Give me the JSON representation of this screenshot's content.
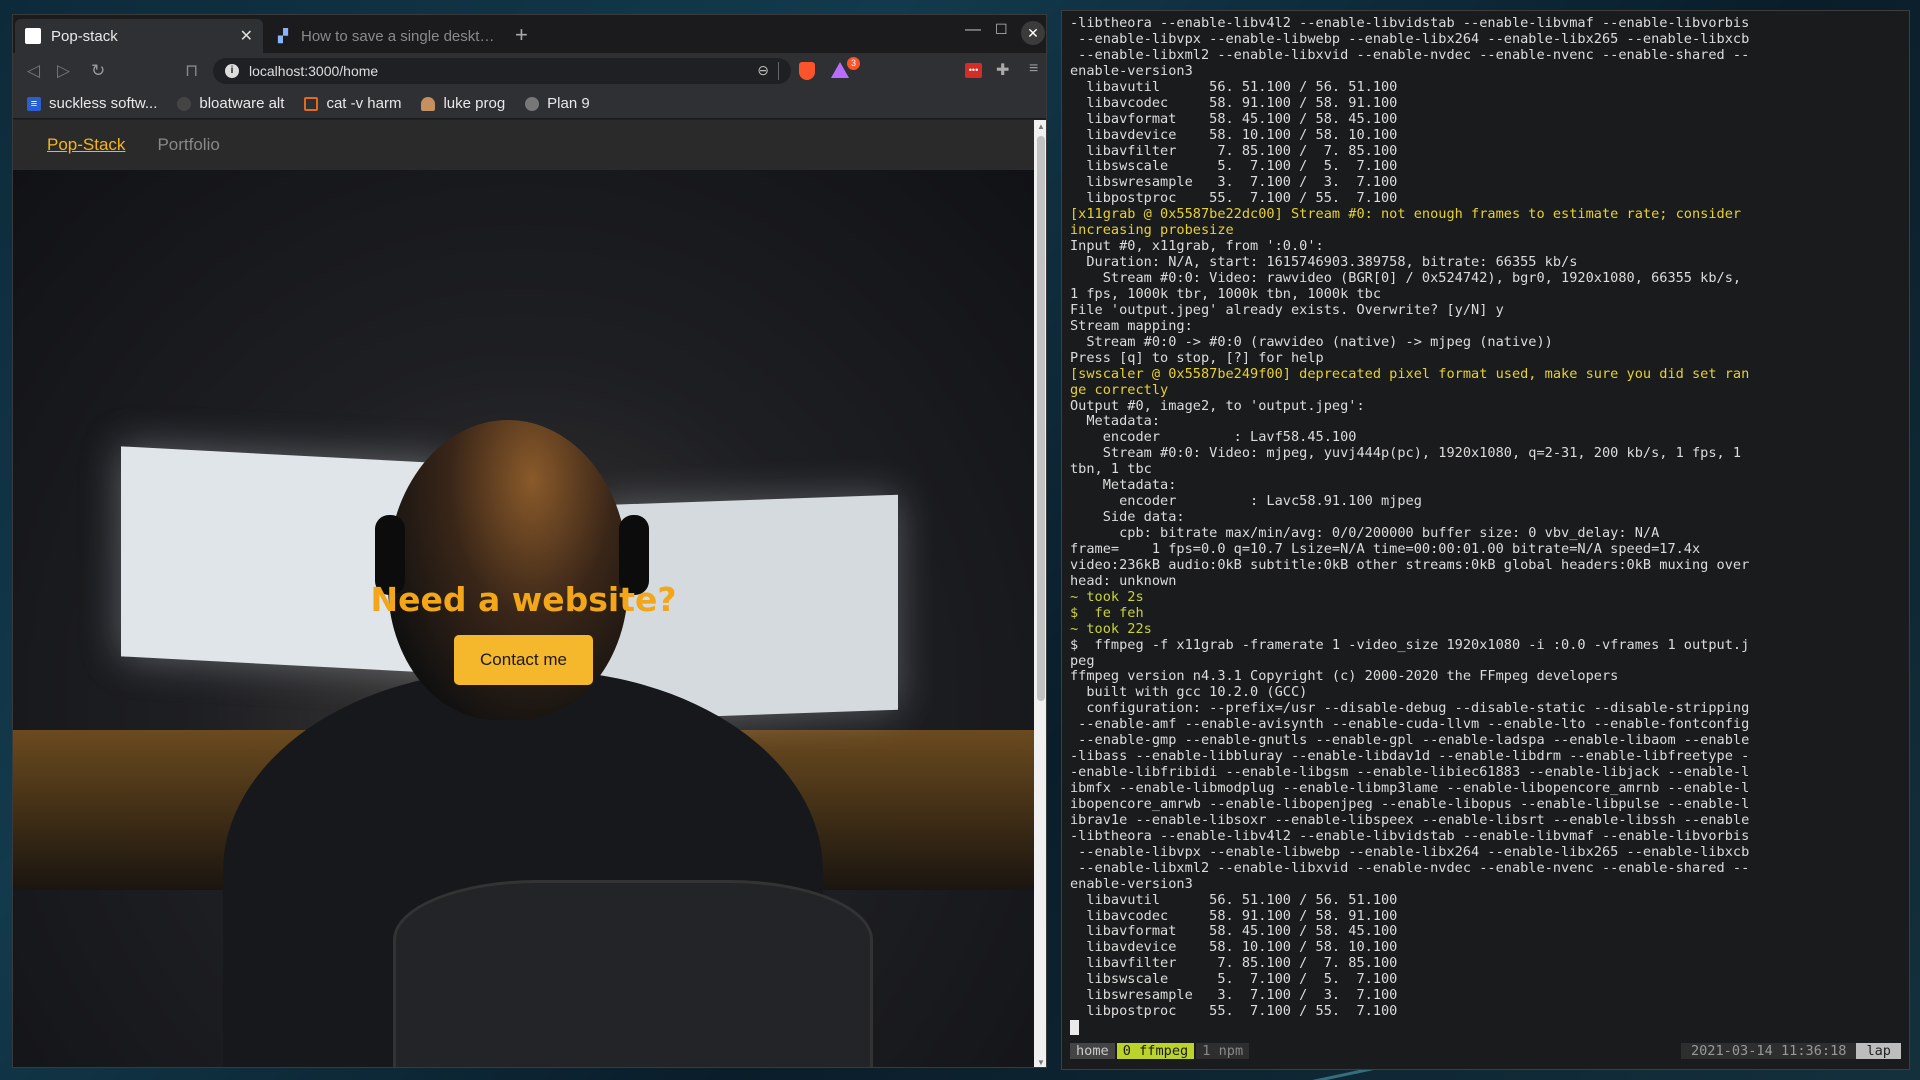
{
  "browser": {
    "tabs": [
      {
        "title": "Pop-stack",
        "close": "✕"
      },
      {
        "title": "How to save a single desktop"
      }
    ],
    "new_tab": "+",
    "window_controls": {
      "minimize": "—",
      "maximize": "☐",
      "close": "✕"
    },
    "url": "localhost:3000/home",
    "rewards_badge": "3",
    "bookmarks": [
      {
        "label": "suckless softw...",
        "icon": "suckless-icon",
        "color": "#2a5fd0"
      },
      {
        "label": "bloatware alt",
        "icon": "github-icon",
        "color": "#444444"
      },
      {
        "label": "cat -v harm",
        "icon": "cat-v-icon",
        "color": "#e06b1f"
      },
      {
        "label": "luke prog",
        "icon": "luke-avatar-icon",
        "color": "#c59060"
      },
      {
        "label": "Plan 9",
        "icon": "plan9-icon",
        "color": "#777777"
      }
    ]
  },
  "site": {
    "nav": {
      "brand": "Pop-Stack",
      "portfolio": "Portfolio"
    },
    "hero": {
      "title": "Need a website?",
      "button": "Contact me"
    },
    "colors": {
      "accent": "#f5b72b",
      "title": "#f2a619"
    }
  },
  "terminal": {
    "lines": [
      {
        "t": "-libtheora --enable-libv4l2 --enable-libvidstab --enable-libvmaf --enable-libvorbis"
      },
      {
        "t": " --enable-libvpx --enable-libwebp --enable-libx264 --enable-libx265 --enable-libxcb"
      },
      {
        "t": " --enable-libxml2 --enable-libxvid --enable-nvdec --enable-nvenc --enable-shared --"
      },
      {
        "t": "enable-version3"
      },
      {
        "t": "  libavutil      56. 51.100 / 56. 51.100"
      },
      {
        "t": "  libavcodec     58. 91.100 / 58. 91.100"
      },
      {
        "t": "  libavformat    58. 45.100 / 58. 45.100"
      },
      {
        "t": "  libavdevice    58. 10.100 / 58. 10.100"
      },
      {
        "t": "  libavfilter     7. 85.100 /  7. 85.100"
      },
      {
        "t": "  libswscale      5.  7.100 /  5.  7.100"
      },
      {
        "t": "  libswresample   3.  7.100 /  3.  7.100"
      },
      {
        "t": "  libpostproc    55.  7.100 / 55.  7.100"
      },
      {
        "t": "[x11grab @ 0x5587be22dc00] Stream #0: not enough frames to estimate rate; consider",
        "c": "c-yellow"
      },
      {
        "t": "increasing probesize",
        "c": "c-yellow"
      },
      {
        "t": "Input #0, x11grab, from ':0.0':"
      },
      {
        "t": "  Duration: N/A, start: 1615746903.389758, bitrate: 66355 kb/s"
      },
      {
        "t": "    Stream #0:0: Video: rawvideo (BGR[0] / 0x524742), bgr0, 1920x1080, 66355 kb/s,"
      },
      {
        "t": "1 fps, 1000k tbr, 1000k tbn, 1000k tbc"
      },
      {
        "t": "File 'output.jpeg' already exists. Overwrite? [y/N] y"
      },
      {
        "t": "Stream mapping:"
      },
      {
        "t": "  Stream #0:0 -> #0:0 (rawvideo (native) -> mjpeg (native))"
      },
      {
        "t": "Press [q] to stop, [?] for help"
      },
      {
        "t": "[swscaler @ 0x5587be249f00] deprecated pixel format used, make sure you did set ran",
        "c": "c-yellow"
      },
      {
        "t": "ge correctly",
        "c": "c-yellow"
      },
      {
        "t": "Output #0, image2, to 'output.jpeg':"
      },
      {
        "t": "  Metadata:"
      },
      {
        "t": "    encoder         : Lavf58.45.100"
      },
      {
        "t": "    Stream #0:0: Video: mjpeg, yuvj444p(pc), 1920x1080, q=2-31, 200 kb/s, 1 fps, 1"
      },
      {
        "t": "tbn, 1 tbc"
      },
      {
        "t": "    Metadata:"
      },
      {
        "t": "      encoder         : Lavc58.91.100 mjpeg"
      },
      {
        "t": "    Side data:"
      },
      {
        "t": "      cpb: bitrate max/min/avg: 0/0/200000 buffer size: 0 vbv_delay: N/A"
      },
      {
        "t": "frame=    1 fps=0.0 q=10.7 Lsize=N/A time=00:00:01.00 bitrate=N/A speed=17.4x"
      },
      {
        "t": "video:236kB audio:0kB subtitle:0kB other streams:0kB global headers:0kB muxing over"
      },
      {
        "t": "head: unknown"
      },
      {
        "t": "~ took 2s",
        "c": "c-green"
      },
      {
        "t": "$  fe feh",
        "c": "c-green"
      },
      {
        "t": "~ took 22s",
        "c": "c-green"
      },
      {
        "t": "$  ffmpeg -f x11grab -framerate 1 -video_size 1920x1080 -i :0.0 -vframes 1 output.j"
      },
      {
        "t": "peg"
      },
      {
        "t": "ffmpeg version n4.3.1 Copyright (c) 2000-2020 the FFmpeg developers"
      },
      {
        "t": "  built with gcc 10.2.0 (GCC)"
      },
      {
        "t": "  configuration: --prefix=/usr --disable-debug --disable-static --disable-stripping"
      },
      {
        "t": " --enable-amf --enable-avisynth --enable-cuda-llvm --enable-lto --enable-fontconfig"
      },
      {
        "t": " --enable-gmp --enable-gnutls --enable-gpl --enable-ladspa --enable-libaom --enable"
      },
      {
        "t": "-libass --enable-libbluray --enable-libdav1d --enable-libdrm --enable-libfreetype -"
      },
      {
        "t": "-enable-libfribidi --enable-libgsm --enable-libiec61883 --enable-libjack --enable-l"
      },
      {
        "t": "ibmfx --enable-libmodplug --enable-libmp3lame --enable-libopencore_amrnb --enable-l"
      },
      {
        "t": "ibopencore_amrwb --enable-libopenjpeg --enable-libopus --enable-libpulse --enable-l"
      },
      {
        "t": "ibrav1e --enable-libsoxr --enable-libspeex --enable-libsrt --enable-libssh --enable"
      },
      {
        "t": "-libtheora --enable-libv4l2 --enable-libvidstab --enable-libvmaf --enable-libvorbis"
      },
      {
        "t": " --enable-libvpx --enable-libwebp --enable-libx264 --enable-libx265 --enable-libxcb"
      },
      {
        "t": " --enable-libxml2 --enable-libxvid --enable-nvdec --enable-nvenc --enable-shared --"
      },
      {
        "t": "enable-version3"
      },
      {
        "t": "  libavutil      56. 51.100 / 56. 51.100"
      },
      {
        "t": "  libavcodec     58. 91.100 / 58. 91.100"
      },
      {
        "t": "  libavformat    58. 45.100 / 58. 45.100"
      },
      {
        "t": "  libavdevice    58. 10.100 / 58. 10.100"
      },
      {
        "t": "  libavfilter     7. 85.100 /  7. 85.100"
      },
      {
        "t": "  libswscale      5.  7.100 /  5.  7.100"
      },
      {
        "t": "  libswresample   3.  7.100 /  3.  7.100"
      },
      {
        "t": "  libpostproc    55.  7.100 / 55.  7.100"
      }
    ],
    "status": {
      "windows": [
        "home",
        "0 ffmpeg",
        "1 npm"
      ],
      "datetime": "2021-03-14 11:36:18",
      "host": "lap"
    }
  }
}
